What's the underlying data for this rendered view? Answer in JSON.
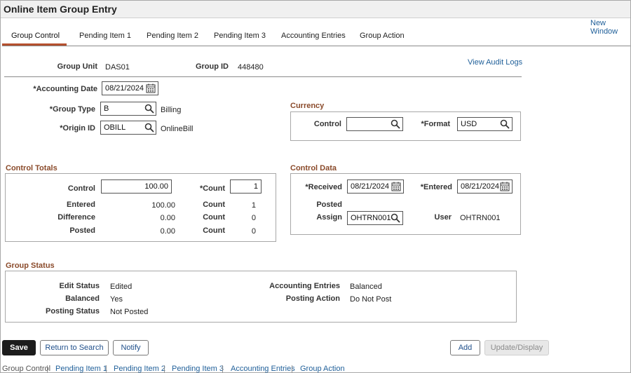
{
  "page": {
    "title": "Online Item Group Entry",
    "new_window": "New Window"
  },
  "tabs": [
    {
      "label": "Group Control"
    },
    {
      "label": "Pending Item 1"
    },
    {
      "label": "Pending Item 2"
    },
    {
      "label": "Pending Item 3"
    },
    {
      "label": "Accounting Entries"
    },
    {
      "label": "Group Action"
    }
  ],
  "header": {
    "group_unit_label": "Group Unit",
    "group_unit_value": "DAS01",
    "group_id_label": "Group ID",
    "group_id_value": "448480",
    "view_audit_logs": "View Audit Logs"
  },
  "form": {
    "accounting_date_label": "*Accounting Date",
    "accounting_date_value": "08/21/2024",
    "group_type_label": "*Group Type",
    "group_type_value": "B",
    "group_type_desc": "Billing",
    "origin_id_label": "*Origin ID",
    "origin_id_value": "OBILL",
    "origin_id_desc": "OnlineBill"
  },
  "currency": {
    "title": "Currency",
    "control_label": "Control",
    "control_value": "",
    "format_label": "*Format",
    "format_value": "USD"
  },
  "control_totals": {
    "title": "Control Totals",
    "control_label": "Control",
    "control_value": "100.00",
    "count_label": "*Count",
    "count_value": "1",
    "entered_label": "Entered",
    "entered_value": "100.00",
    "entered_count_label": "Count",
    "entered_count": "1",
    "difference_label": "Difference",
    "difference_value": "0.00",
    "difference_count_label": "Count",
    "difference_count": "0",
    "posted_label": "Posted",
    "posted_value": "0.00",
    "posted_count_label": "Count",
    "posted_count": "0"
  },
  "control_data": {
    "title": "Control Data",
    "received_label": "*Received",
    "received_value": "08/21/2024",
    "entered_label": "*Entered",
    "entered_value": "08/21/2024",
    "posted_label": "Posted",
    "assign_label": "Assign",
    "assign_value": "OHTRN001",
    "user_label": "User",
    "user_value": "OHTRN001"
  },
  "group_status": {
    "title": "Group Status",
    "edit_status_label": "Edit Status",
    "edit_status_value": "Edited",
    "balanced_label": "Balanced",
    "balanced_value": "Yes",
    "posting_status_label": "Posting Status",
    "posting_status_value": "Not Posted",
    "accounting_entries_label": "Accounting Entries",
    "accounting_entries_value": "Balanced",
    "posting_action_label": "Posting Action",
    "posting_action_value": "Do Not Post"
  },
  "buttons": {
    "save": "Save",
    "return_to_search": "Return to Search",
    "notify": "Notify",
    "add": "Add",
    "update_display": "Update/Display"
  },
  "footer_links": [
    "Group Control",
    "Pending Item 1",
    "Pending Item 2",
    "Pending Item 3",
    "Accounting Entries",
    "Group Action"
  ],
  "colors": {
    "accent": "#b5502e",
    "section_title": "#8a4a2a",
    "link": "#1f5f99"
  }
}
